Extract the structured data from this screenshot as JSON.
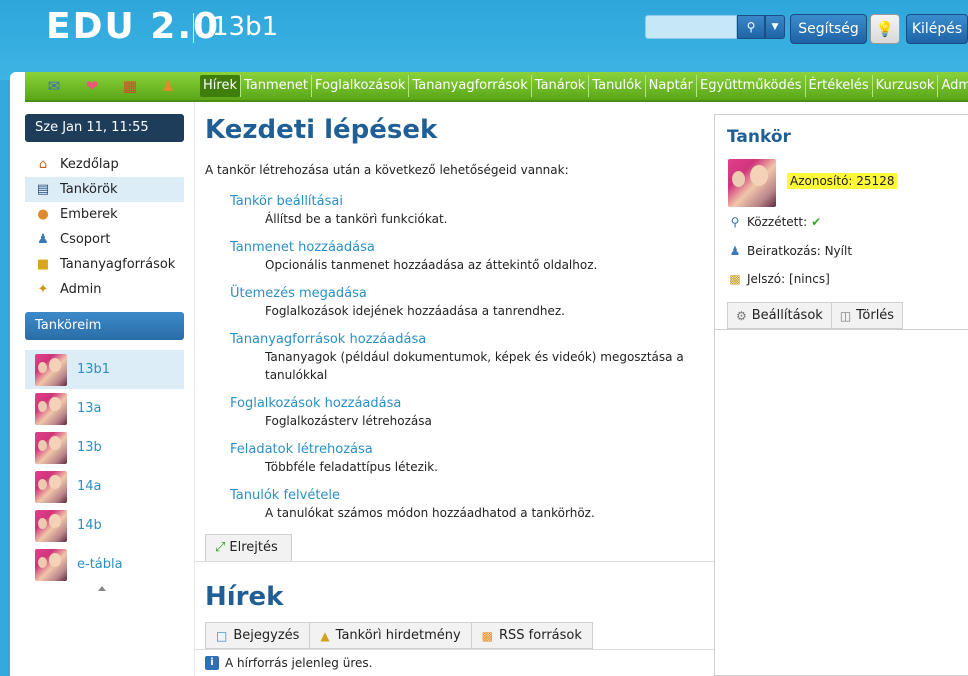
{
  "header": {
    "logo_main": "EDU",
    "logo_version": "2.0",
    "class_name": "13b1",
    "help_label": "Segítség",
    "logout_label": "Kilépés",
    "search_icon": "magnifier-icon",
    "bulb_icon": "lightbulb-icon"
  },
  "nav": {
    "icons": [
      "mail-icon",
      "heart-icon",
      "calendar-icon",
      "people-icon"
    ],
    "links": [
      "Hírek",
      "Tanmenet",
      "Foglalkozások",
      "Tananyagforrások",
      "Tanárok",
      "Tanulók",
      "Naptár",
      "Együttműködés",
      "Értékelés",
      "Kurzusok",
      "Admin"
    ],
    "active": "Hírek"
  },
  "sidebar": {
    "date": "Sze Jan 11, 11:55",
    "items": [
      {
        "label": "Kezdőlap",
        "icon": "home-icon"
      },
      {
        "label": "Tankörök",
        "icon": "book-icon"
      },
      {
        "label": "Emberek",
        "icon": "person-icon"
      },
      {
        "label": "Csoport",
        "icon": "group-icon"
      },
      {
        "label": "Tananyagforrások",
        "icon": "folder-icon"
      },
      {
        "label": "Admin",
        "icon": "wand-icon"
      }
    ],
    "section_title": "Tanköreim",
    "classes": [
      "13b1",
      "13a",
      "13b",
      "14a",
      "14b",
      "e-tábla"
    ]
  },
  "main": {
    "title": "Kezdeti lépések",
    "intro": "A tankör létrehozása után a következő lehetőségeid vannak:",
    "steps": [
      {
        "title": "Tankör beállításai",
        "desc": "Állítsd be a tankörì funkciókat."
      },
      {
        "title": "Tanmenet hozzáadása",
        "desc": "Opcionális tanmenet hozzáadása az áttekintő oldalhoz."
      },
      {
        "title": "Ütemezés megadása",
        "desc": "Foglalkozások idejének hozzáadása a tanrendhez."
      },
      {
        "title": "Tananyagforrások hozzáadása",
        "desc": "Tananyagok (például dokumentumok, képek és videók) megosztása a tanulókkal"
      },
      {
        "title": "Foglalkozások hozzáadása",
        "desc": "Foglalkozásterv létrehozása"
      },
      {
        "title": "Feladatok létrehozása",
        "desc": "Többféle feladattípus létezik."
      },
      {
        "title": "Tanulók felvétele",
        "desc": "A tanulókat számos módon hozzáadhatod a tankörhöz."
      }
    ],
    "hide_label": "Elrejtés",
    "news_title": "Hírek",
    "news_tabs": [
      {
        "label": "Bejegyzés",
        "icon": "speech-bubble-icon"
      },
      {
        "label": "Tankörì hirdetmény",
        "icon": "bell-icon"
      },
      {
        "label": "RSS források",
        "icon": "rss-icon"
      }
    ],
    "empty_message": "A hírforrás jelenleg üres."
  },
  "panel": {
    "title": "Tankör",
    "id_text": "Azonosító: 25128",
    "published_label": "Közzétett:",
    "enroll_text": "Beiratkozás: Nyílt",
    "password_text": "Jelszó: [nincs]",
    "settings_label": "Beállítások",
    "delete_label": "Törlés"
  }
}
